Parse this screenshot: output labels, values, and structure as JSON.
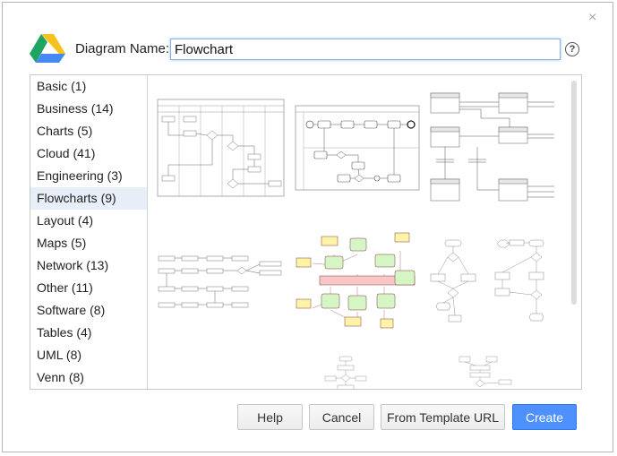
{
  "dialog": {
    "name_label": "Diagram Name:",
    "name_value": "Flowchart",
    "help_glyph": "?",
    "close_glyph": "×"
  },
  "categories": [
    {
      "label": "Basic (1)"
    },
    {
      "label": "Business (14)"
    },
    {
      "label": "Charts (5)"
    },
    {
      "label": "Cloud (41)"
    },
    {
      "label": "Engineering (3)"
    },
    {
      "label": "Flowcharts (9)",
      "selected": true
    },
    {
      "label": "Layout (4)"
    },
    {
      "label": "Maps (5)"
    },
    {
      "label": "Network (13)"
    },
    {
      "label": "Other (11)"
    },
    {
      "label": "Software (8)"
    },
    {
      "label": "Tables (4)"
    },
    {
      "label": "UML (8)"
    },
    {
      "label": "Venn (8)"
    }
  ],
  "buttons": {
    "help": "Help",
    "cancel": "Cancel",
    "from_url": "From Template URL",
    "create": "Create"
  },
  "colors": {
    "accent": "#4d90fe",
    "selected_bg": "#e8eef7",
    "node_green": "#d5f5c4",
    "node_yellow": "#fff3a8",
    "node_red": "#f8c6c6"
  },
  "icons": {
    "logo": "google-drive-icon",
    "help": "help-circle-icon",
    "close": "close-icon"
  }
}
